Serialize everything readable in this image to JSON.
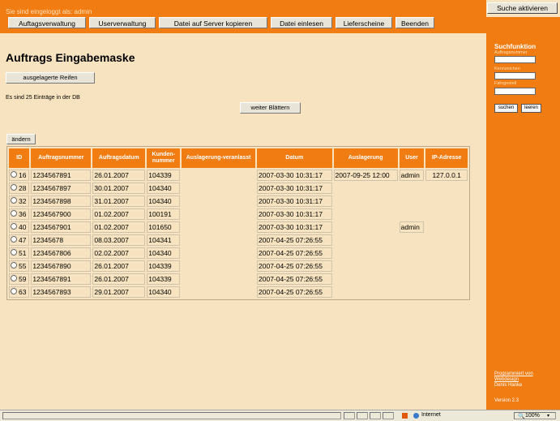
{
  "header": {
    "logged_in": "Sie sind eingeloggt als: admin",
    "nav": [
      "Auftagsverwaltung",
      "Userverwaltung",
      "Datei auf Server kopieren",
      "Datei einlesen",
      "Lieferscheine",
      "Beenden"
    ]
  },
  "sidebar": {
    "search_toggle": "Suche aktivieren",
    "title": "Suchfunktion",
    "labels": [
      "Auftragsnummer",
      "Kennzeichen",
      "Fahrgestell"
    ],
    "search_button": "suchen",
    "clear_button": "leeren",
    "credits_line1": "Programmiert von",
    "credits_line2": "Webdesign",
    "credits_line3": "Denis Hanke",
    "version": "Version 2.3"
  },
  "main": {
    "title": "Auftrags Eingabemaske",
    "tires_button": "ausgelagerte Reifen",
    "entry_count": "Es sind 25 Einträge in der DB",
    "next_button": "weiter Blättern",
    "edit_button": "ändern"
  },
  "table": {
    "headers": [
      "ID",
      "Auftragsnummer",
      "Auftragsdatum",
      "Kunden-\nnummer",
      "Auslagerung-veranlasst",
      "Datum",
      "Auslagerung",
      "User",
      "IP-Adresse"
    ],
    "rows": [
      [
        "16",
        "1234567891",
        "26.01.2007",
        "104339",
        "",
        "2007-03-30 10:31:17",
        "2007-09-25 12:00",
        "admin",
        "127.0.0.1"
      ],
      [
        "28",
        "1234567897",
        "30.01.2007",
        "104340",
        "",
        "2007-03-30 10:31:17",
        "",
        "",
        ""
      ],
      [
        "32",
        "1234567898",
        "31.01.2007",
        "104340",
        "",
        "2007-03-30 10:31:17",
        "",
        "",
        ""
      ],
      [
        "36",
        "1234567900",
        "01.02.2007",
        "100191",
        "",
        "2007-03-30 10:31:17",
        "",
        "",
        ""
      ],
      [
        "40",
        "1234567901",
        "01.02.2007",
        "101650",
        "",
        "2007-03-30 10:31:17",
        "",
        "admin",
        ""
      ],
      [
        "47",
        "12345678",
        "08.03.2007",
        "104341",
        "",
        "2007-04-25 07:26:55",
        "",
        "",
        ""
      ],
      [
        "51",
        "1234567806",
        "02.02.2007",
        "104340",
        "",
        "2007-04-25 07:26:55",
        "",
        "",
        ""
      ],
      [
        "55",
        "1234567890",
        "26.01.2007",
        "104339",
        "",
        "2007-04-25 07:26:55",
        "",
        "",
        ""
      ],
      [
        "59",
        "1234567891",
        "26.01.2007",
        "104339",
        "",
        "2007-04-25 07:26:55",
        "",
        "",
        ""
      ],
      [
        "63",
        "1234567893",
        "29.01.2007",
        "104340",
        "",
        "2007-04-25 07:26:55",
        "",
        "",
        ""
      ]
    ]
  },
  "statusbar": {
    "zone": "Internet",
    "zoom": "100%"
  },
  "colors": {
    "accent": "#f07c12",
    "background": "#f7e3c0"
  }
}
